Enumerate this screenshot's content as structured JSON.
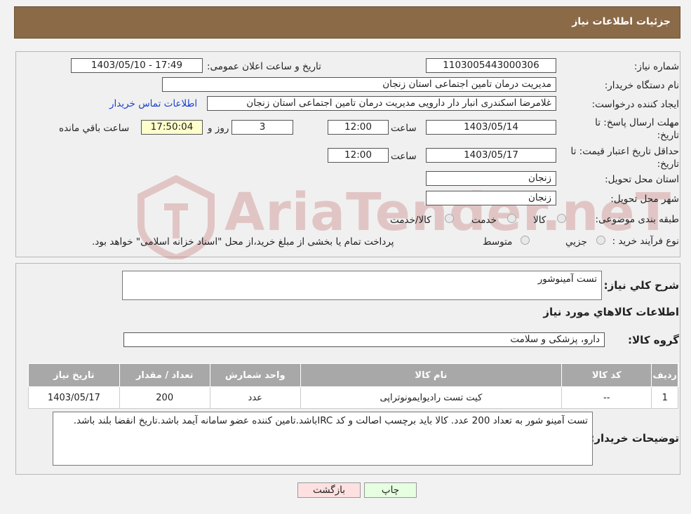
{
  "header": {
    "title": "جزئیات اطلاعات نیاز"
  },
  "form": {
    "need_number_label": "شماره نیاز:",
    "need_number": "1103005443000306",
    "announce_label": "تاریخ و ساعت اعلان عمومی:",
    "announce_value": "1403/05/10 - 17:49",
    "buyer_org_label": "نام دستگاه خریدار:",
    "buyer_org": "مدیریت درمان تامین اجتماعی استان زنجان",
    "requester_label": "ایجاد کننده درخواست:",
    "requester": "غلامرضا  اسکندری انبار دار دارویی مدیریت درمان تامین اجتماعی استان زنجان",
    "contact_link": "اطلاعات تماس خریدار",
    "deadline_label": "مهلت ارسال پاسخ: تا تاریخ:",
    "deadline_date": "1403/05/14",
    "time_label": "ساعت",
    "deadline_time": "12:00",
    "days": "3",
    "days_label": "روز و",
    "remaining_time": "17:50:04",
    "remaining_label": "ساعت باقي مانده",
    "validity_label": "حداقل تاریخ اعتبار قیمت: تا تاریخ:",
    "validity_date": "1403/05/17",
    "validity_time_label": "ساعت",
    "validity_time": "12:00",
    "province_label": "استان محل تحویل:",
    "province": "زنجان",
    "city_label": "شهر محل تحویل:",
    "city": "زنجان",
    "category_label": "طبقه بندی موضوعی:",
    "category_options": [
      "کالا",
      "خدمت",
      "کالا/خدمت"
    ],
    "process_label": "نوع فرآیند خرید :",
    "process_options": [
      "جزیي",
      "متوسط"
    ],
    "process_note": "پرداخت تمام یا بخشی از مبلغ خرید،از محل \"اسناد خزانه اسلامی\" خواهد بود."
  },
  "details": {
    "summary_label": "شرح کلي نیاز:",
    "summary_value": "تست آمینوشور",
    "goods_info_title": "اطلاعات کالاهاي مورد نیاز",
    "group_label": "گروه کالا:",
    "group_value": "دارو، پزشکی و سلامت",
    "table": {
      "headers": [
        "ردیف",
        "کد کالا",
        "نام کالا",
        "واحد شمارش",
        "تعداد / مقدار",
        "تاریخ نیاز"
      ],
      "rows": [
        [
          "1",
          "--",
          "کیت تست رادیوایمونوتراپی",
          "عدد",
          "200",
          "1403/05/17"
        ]
      ]
    },
    "buyer_notes_label": "توضیحات خریدار:",
    "buyer_notes": "تست آمینو شور به تعداد 200 عدد. کالا باید برچسب اصالت و کد IRCباشد.تامین کننده عضو سامانه آیمد باشد.تاریخ انقضا بلند باشد."
  },
  "buttons": {
    "print": "چاپ",
    "back": "بازگشت"
  },
  "watermark": {
    "text": "AriaTender.neT"
  },
  "colors": {
    "header_bg": "#8b6a48",
    "table_header_bg": "#a8a8a8",
    "print_btn": "#e6ffe0",
    "back_btn": "#ffe0e0",
    "link": "#1a3fd0"
  }
}
